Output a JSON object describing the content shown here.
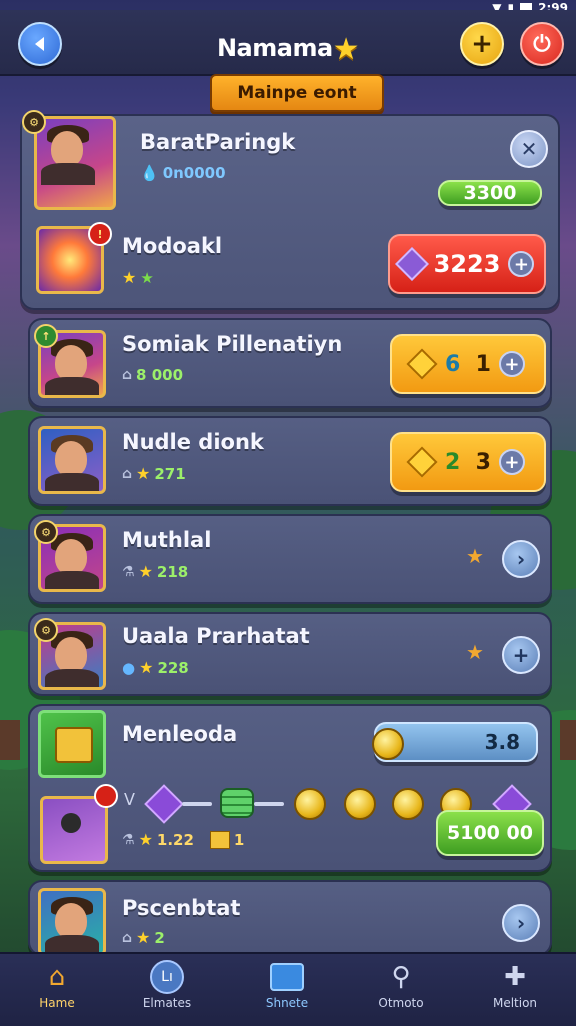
{
  "status": {
    "time": "2:99"
  },
  "header": {
    "title": "Namama",
    "ribbon": "Mainpe eont"
  },
  "profile": {
    "name": "BaratParingk",
    "currency": "0n0000",
    "progress_value": "3300"
  },
  "items": [
    {
      "name": "Modoakl",
      "price": "3223",
      "color": "#d62117"
    },
    {
      "name": "Somiak Pillenatiyn",
      "sub_value": "8 000",
      "price_a": "6",
      "price_b": "1"
    },
    {
      "name": "Nudle dionk",
      "sub_value": "271",
      "price_a": "2",
      "price_b": "3"
    },
    {
      "name": "Muthlal",
      "sub_value": "218"
    },
    {
      "name": "Uaala Prarhatat",
      "sub_value": "228"
    },
    {
      "name": "Menleoda",
      "progress_value": "3.8",
      "sub_value": "1.22",
      "sub_value_2": "1",
      "reward": "5100",
      "reward_unit": "00"
    },
    {
      "name": "Pscenbtat",
      "sub_value": "2"
    }
  ],
  "nav": [
    {
      "label": "Hame",
      "icon": "home-icon"
    },
    {
      "label": "Elmates",
      "icon": "stats-icon"
    },
    {
      "label": "Shnete",
      "icon": "shop-icon"
    },
    {
      "label": "Otmoto",
      "icon": "search-icon"
    },
    {
      "label": "Meltion",
      "icon": "puzzle-icon"
    }
  ]
}
